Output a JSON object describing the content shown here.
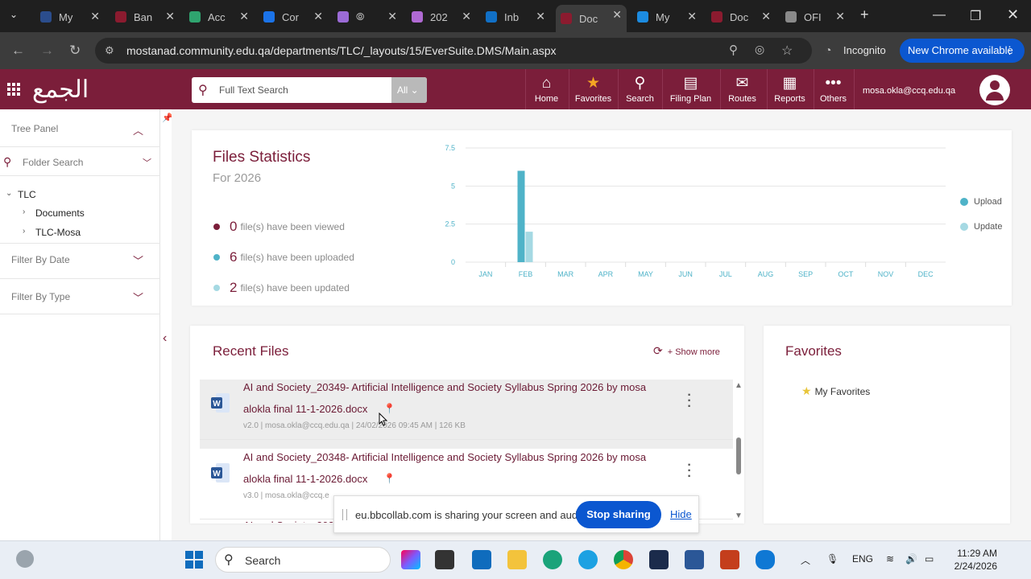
{
  "browser": {
    "tabs": [
      {
        "title": "My",
        "color": "#2b4d8c",
        "active": false
      },
      {
        "title": "Ban",
        "color": "#8b1b2f",
        "active": false
      },
      {
        "title": "Acc",
        "color": "#2fa46f",
        "active": false
      },
      {
        "title": "Cor",
        "color": "#1b73e8",
        "active": false
      },
      {
        "title": "⦾",
        "color": "#9b6bd6",
        "active": false
      },
      {
        "title": "202",
        "color": "#b06ad3",
        "active": false
      },
      {
        "title": "Inb",
        "color": "#1170c6",
        "active": false
      },
      {
        "title": "Doc",
        "color": "#8b1b2f",
        "active": true
      },
      {
        "title": "My",
        "color": "#1c8be0",
        "active": false
      },
      {
        "title": "Doc",
        "color": "#8b1b2f",
        "active": false
      },
      {
        "title": "OFI",
        "color": "#8a8a8a",
        "active": false
      }
    ],
    "url": "mostanad.community.edu.qa/departments/TLC/_layouts/15/EverSuite.DMS/Main.aspx",
    "incognito_label": "Incognito",
    "new_chrome_label": "New Chrome available"
  },
  "header": {
    "logo_text": "الجمع",
    "search_placeholder": "Full Text Search",
    "search_scope": "All",
    "nav": [
      {
        "label": "Home",
        "icon": "home-icon",
        "glyph": "⌂"
      },
      {
        "label": "Favorites",
        "icon": "star-icon",
        "glyph": "★"
      },
      {
        "label": "Search",
        "icon": "search-icon",
        "glyph": "⚲"
      },
      {
        "label": "Filing Plan",
        "icon": "filing-plan-icon",
        "glyph": "▤"
      },
      {
        "label": "Routes",
        "icon": "routes-icon",
        "glyph": "✉"
      },
      {
        "label": "Reports",
        "icon": "reports-icon",
        "glyph": "▦"
      },
      {
        "label": "Others",
        "icon": "others-icon",
        "glyph": "•••"
      }
    ],
    "user_email": "mosa.okla@ccq.edu.qa"
  },
  "sidebar": {
    "tree_panel": "Tree Panel",
    "folder_search": "Folder Search",
    "root": "TLC",
    "children": [
      "Documents",
      "TLC-Mosa"
    ],
    "filter_date": "Filter By Date",
    "filter_type": "Filter By Type"
  },
  "stats": {
    "title": "Files Statistics",
    "subtitle": "For 2026",
    "rows": [
      {
        "count": "0",
        "text": "file(s) have been viewed",
        "color": "#7b1e3a"
      },
      {
        "count": "6",
        "text": "file(s) have been uploaded",
        "color": "#4fb3c8"
      },
      {
        "count": "2",
        "text": "file(s) have been updated",
        "color": "#a5d9e3"
      }
    ]
  },
  "chart_data": {
    "type": "bar",
    "categories": [
      "JAN",
      "FEB",
      "MAR",
      "APR",
      "MAY",
      "JUN",
      "JUL",
      "AUG",
      "SEP",
      "OCT",
      "NOV",
      "DEC"
    ],
    "series": [
      {
        "name": "Upload",
        "color": "#4fb3c8",
        "values": [
          0,
          6,
          0,
          0,
          0,
          0,
          0,
          0,
          0,
          0,
          0,
          0
        ]
      },
      {
        "name": "Update",
        "color": "#a5d9e3",
        "values": [
          0,
          2,
          0,
          0,
          0,
          0,
          0,
          0,
          0,
          0,
          0,
          0
        ]
      }
    ],
    "yticks": [
      "0",
      "2.5",
      "5",
      "7.5"
    ],
    "ylim": [
      0,
      7.5
    ],
    "grid": true,
    "legend": "right"
  },
  "recent": {
    "title": "Recent Files",
    "show_more": "+ Show more",
    "files": [
      {
        "line1": "AI and Society_20349- Artificial Intelligence and Society Syllabus Spring 2026 by mosa",
        "line2": "alokla final 11-1-2026.docx",
        "meta": "v2.0  |  mosa.okla@ccq.edu.qa  |  24/02/2026 09:45 AM  |  126 KB"
      },
      {
        "line1": "AI and Society_20348- Artificial Intelligence and Society Syllabus Spring 2026 by mosa",
        "line2": "alokla final 11-1-2026.docx",
        "meta": "v3.0  |  mosa.okla@ccq.e"
      },
      {
        "line1": "AI and Society_203",
        "line2": "",
        "meta": ""
      }
    ]
  },
  "favorites": {
    "title": "Favorites",
    "item": "My Favorites"
  },
  "share_bar": {
    "message": "eu.bbcollab.com is sharing your screen and audio.",
    "stop_label": "Stop sharing",
    "hide_label": "Hide"
  },
  "taskbar": {
    "search_label": "Search",
    "lang": "ENG",
    "time": "11:29 AM",
    "date": "2/24/2026"
  }
}
